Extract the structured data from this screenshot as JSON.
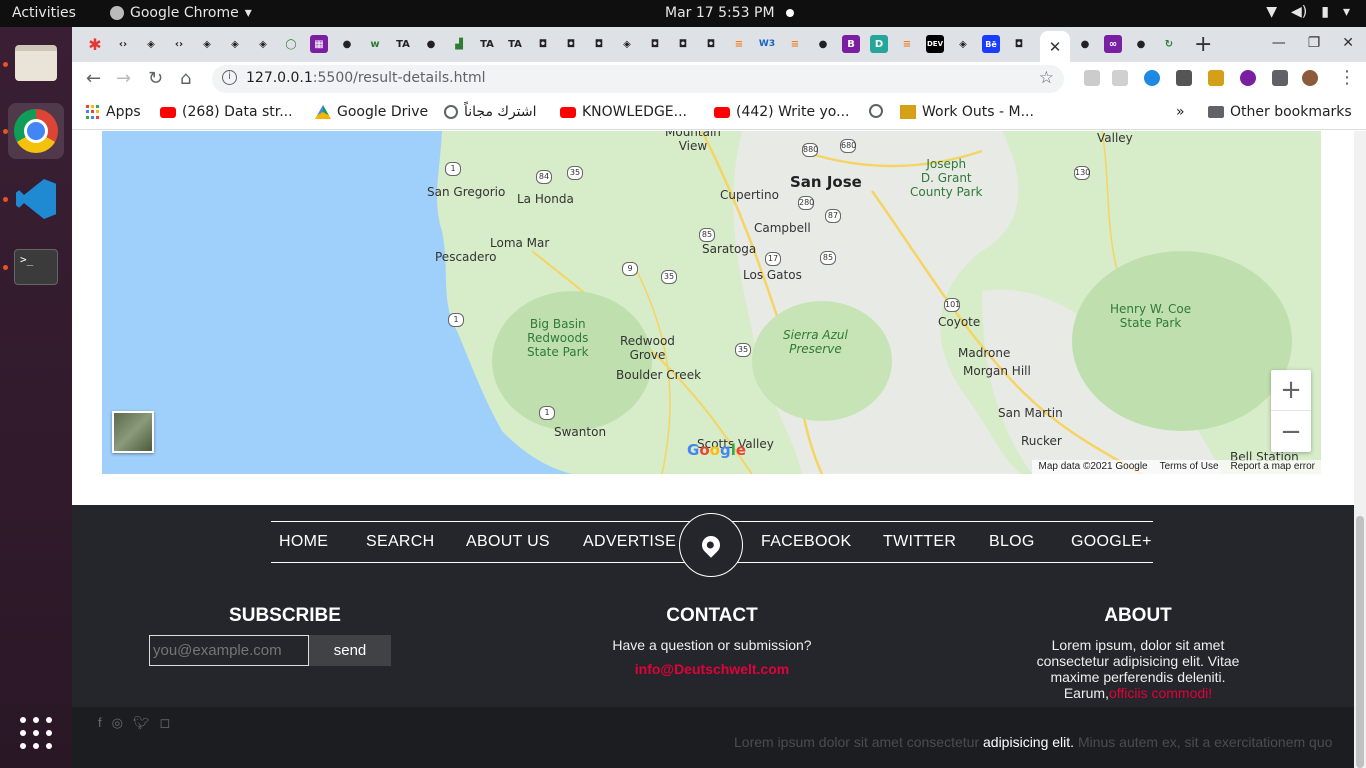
{
  "system_bar": {
    "activities": "Activities",
    "app_name": "Google Chrome",
    "clock": "Mar 17  5:53 PM"
  },
  "browser": {
    "url_host": "127.0.0.1",
    "url_path": ":5500/result-details.html",
    "bookmarks": [
      {
        "label": "Apps",
        "icon": "apps-icon"
      },
      {
        "label": "(268) Data str...",
        "icon": "youtube-icon"
      },
      {
        "label": "Google Drive",
        "icon": "google-drive-icon"
      },
      {
        "label": "اشترك مجاناً",
        "icon": "globe-icon"
      },
      {
        "label": "KNOWLEDGE...",
        "icon": "youtube-icon"
      },
      {
        "label": "(442) Write yo...",
        "icon": "youtube-icon"
      },
      {
        "label": "",
        "icon": "globe-icon"
      },
      {
        "label": "Work Outs - M...",
        "icon": "workouts-icon"
      }
    ],
    "more_bookmarks": "»",
    "other_bookmarks": "Other bookmarks"
  },
  "map": {
    "labels": {
      "mountain_view": "Mountain\nView",
      "valley": "Valley",
      "san_jose": "San Jose",
      "joseph_grant": "Joseph\nD. Grant\nCounty Park",
      "san_gregorio": "San Gregorio",
      "la_honda": "La Honda",
      "cupertino": "Cupertino",
      "campbell": "Campbell",
      "loma_mar": "Loma Mar",
      "pescadero": "Pescadero",
      "saratoga": "Saratoga",
      "los_gatos": "Los Gatos",
      "coyote": "Coyote",
      "henry_coe": "Henry W. Coe\nState Park",
      "big_basin": "Big Basin\nRedwoods\nState Park",
      "redwood_grove": "Redwood\nGrove",
      "sierra_azul": "Sierra Azul\nPreserve",
      "madrone": "Madrone",
      "morgan_hill": "Morgan Hill",
      "boulder_creek": "Boulder Creek",
      "swanton": "Swanton",
      "scotts_valley": "Scotts Valley",
      "san_martin": "San Martin",
      "rucker": "Rucker",
      "bell_station": "Bell Station"
    },
    "shields": [
      "880",
      "680",
      "1",
      "84",
      "35",
      "280",
      "87",
      "130",
      "85",
      "9",
      "35",
      "17",
      "85",
      "101",
      "1",
      "35",
      "1"
    ],
    "google_logo": "Google",
    "attribution": "Map data ©2021 Google",
    "terms": "Terms of Use",
    "report": "Report a map error",
    "zoom_in": "+",
    "zoom_out": "−"
  },
  "footer": {
    "nav": [
      "HOME",
      "SEARCH",
      "ABOUT US",
      "ADVERTISE",
      "FACEBOOK",
      "TWITTER",
      "BLOG",
      "GOOGLE+"
    ],
    "subscribe": {
      "title": "SUBSCRIBE",
      "placeholder": "you@example.com",
      "button": "send"
    },
    "contact": {
      "title": "CONTACT",
      "question": "Have a question or submission?",
      "email": "info@Deutschwelt.com"
    },
    "about": {
      "title": "ABOUT",
      "text": "Lorem ipsum, dolor sit amet consectetur adipisicing elit. Vitae maxime perferendis deleniti. Earum,",
      "highlight": "officiis commodi!"
    },
    "marquee": {
      "before": "Lorem ipsum dolor sit amet consectetur ",
      "highlight": "adipisicing elit.",
      "after": " Minus autem ex, sit a exercitationem quo"
    }
  },
  "colors": {
    "footer_bg": "#24262b",
    "accent_red": "#e4003a",
    "ocean": "#9fd0fb",
    "land": "#d7ecc9"
  }
}
